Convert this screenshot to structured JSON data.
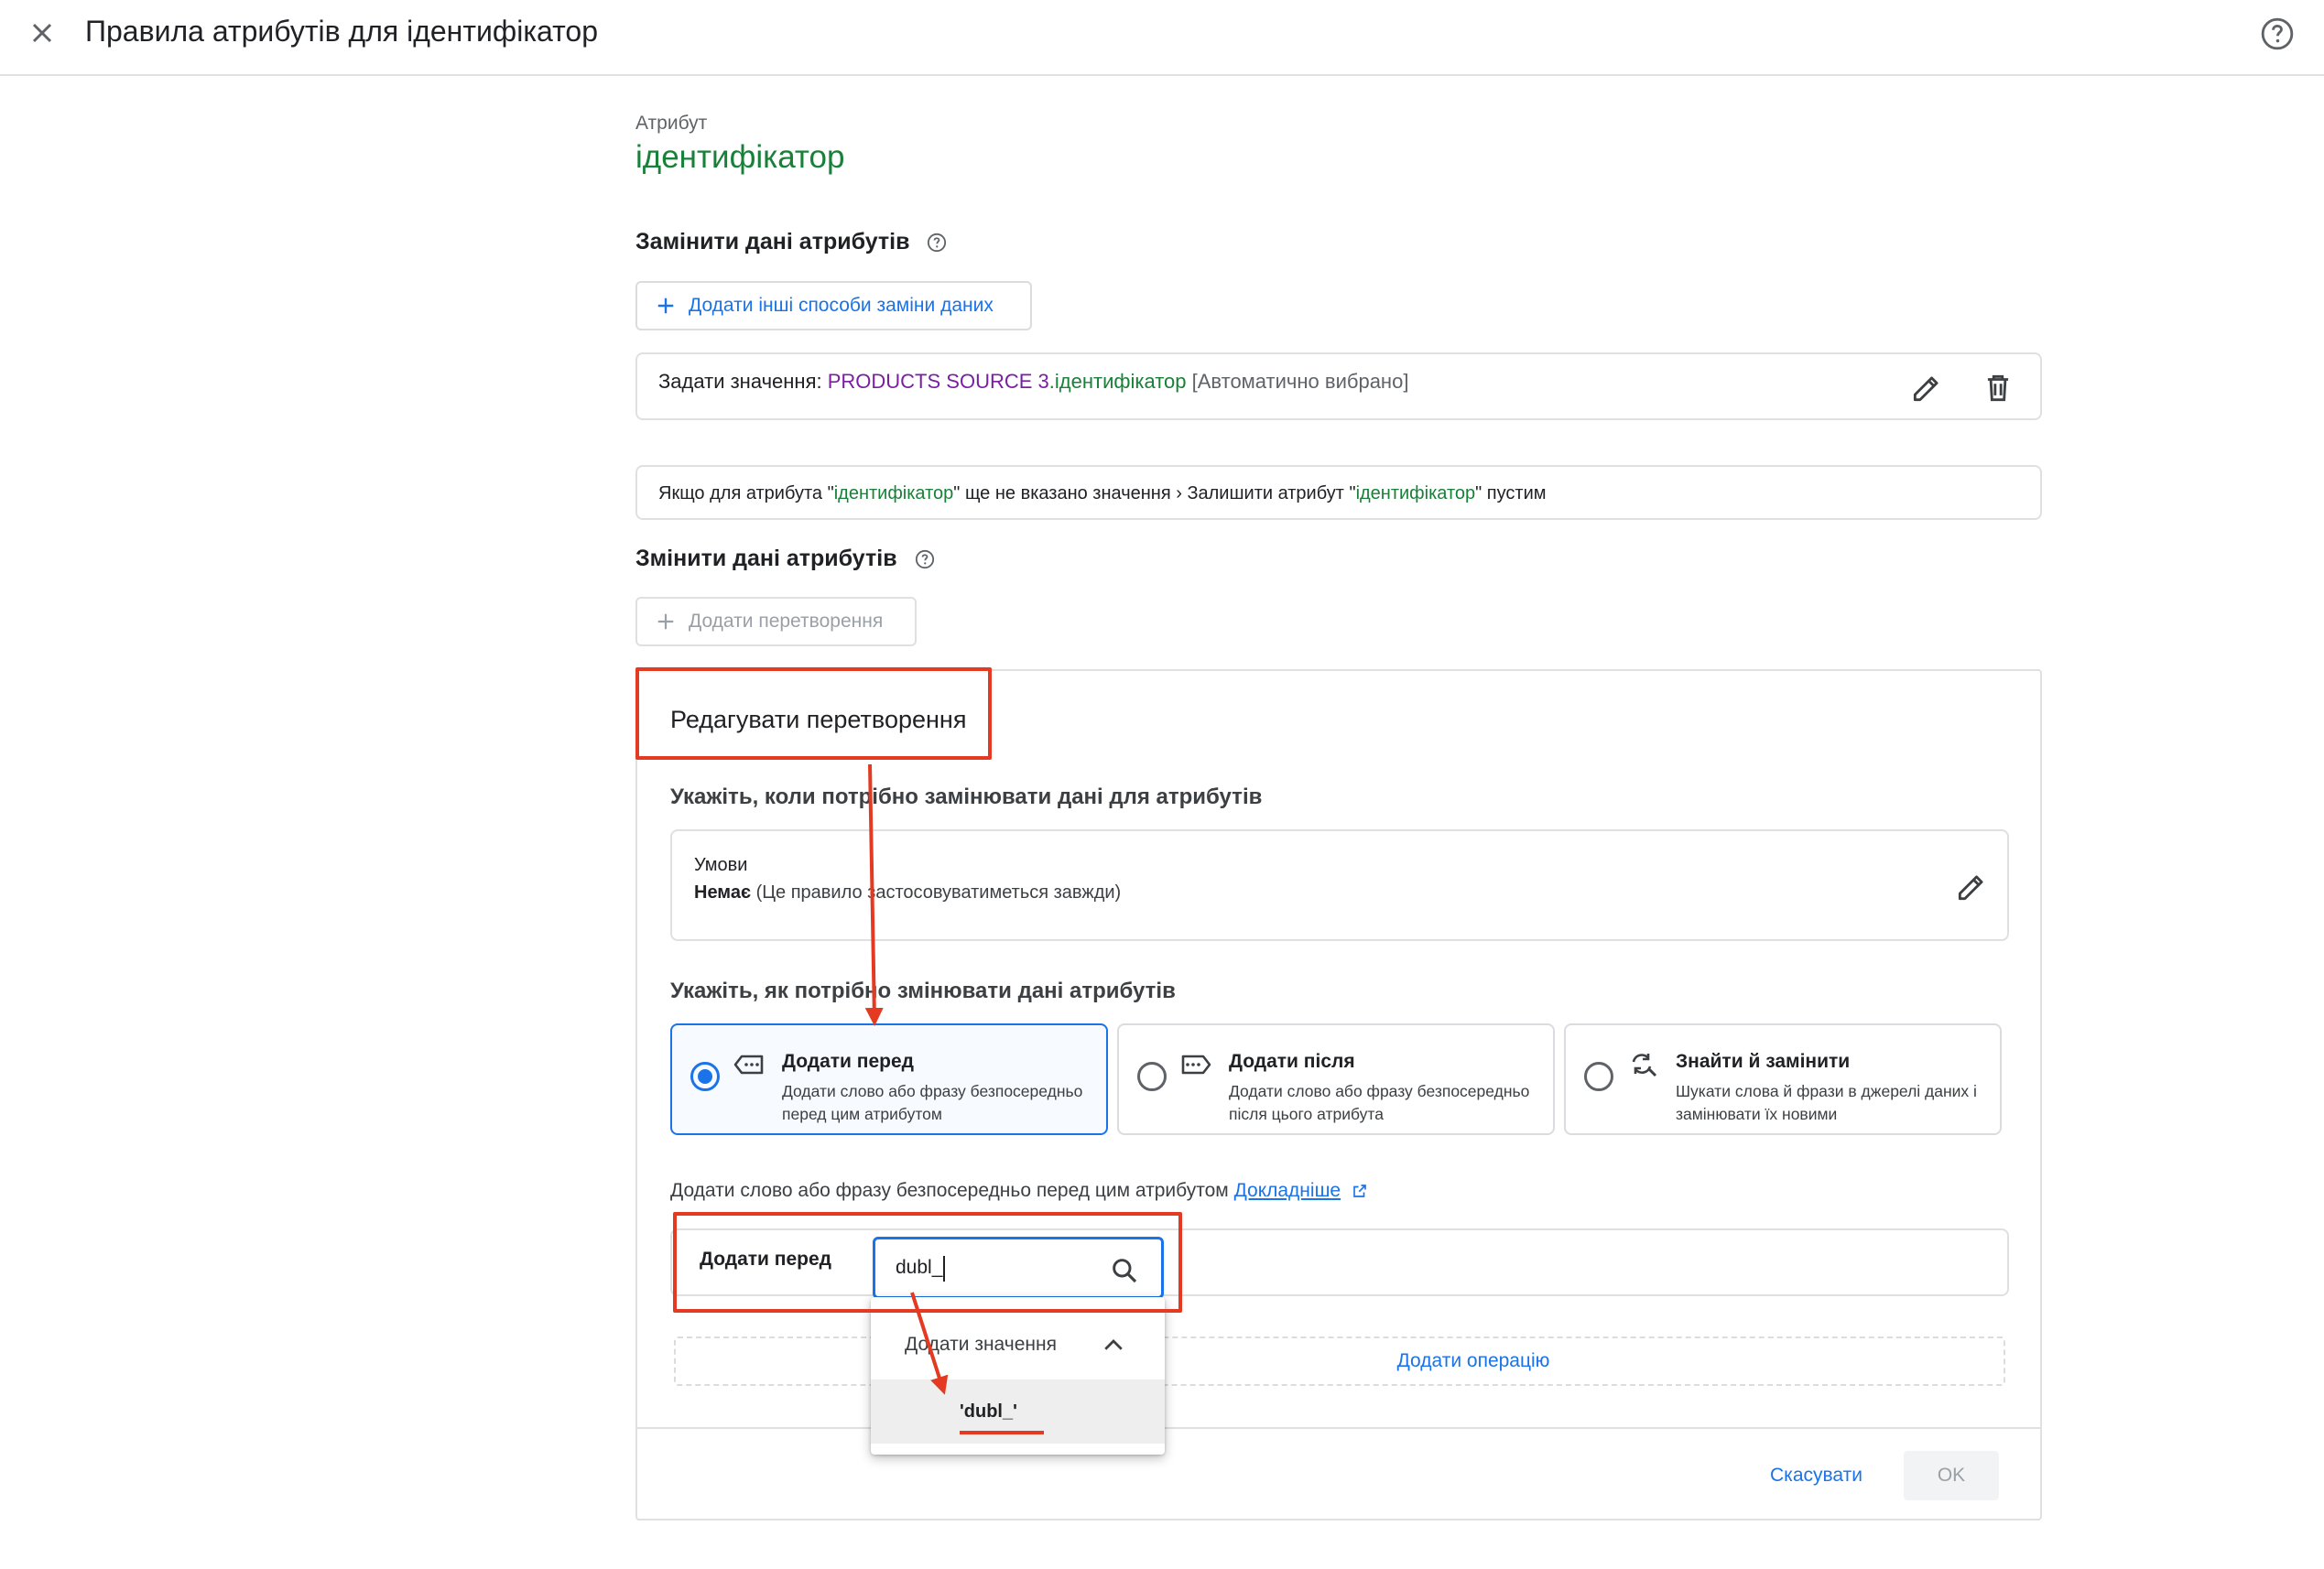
{
  "header": {
    "title": "Правила атрибутів для ідентифікатор"
  },
  "attribute": {
    "label": "Атрибут",
    "name": "ідентифікатор"
  },
  "replace_section": {
    "title": "Замінити дані атрибутів",
    "add_button": "Додати інші способи заміни даних",
    "rule": {
      "prefix": "Задати значення: ",
      "source": "PRODUCTS SOURCE 3",
      "dot": ".",
      "field": "ідентифікатор",
      "suffix": " [Автоматично вибрано]"
    },
    "fallback": {
      "p1": "Якщо для атрибута \"",
      "attr1": "ідентифікатор",
      "p2": "\" ще не вказано значення › Залишити атрибут \"",
      "attr2": "ідентифікатор",
      "p3": "\" пустим"
    }
  },
  "modify_section": {
    "title": "Змінити дані атрибутів",
    "add_button": "Додати перетворення"
  },
  "edit_panel": {
    "title": "Редагувати перетворення",
    "when_title": "Укажіть, коли потрібно замінювати дані для атрибутів",
    "conditions_label": "Умови",
    "conditions_value_bold": "Немає",
    "conditions_value_rest": " (Це правило застосовуватиметься завжди)",
    "how_title": "Укажіть, як потрібно змінювати дані атрибутів",
    "options": [
      {
        "title": "Додати перед",
        "desc": "Додати слово або фразу безпосередньо перед цим атрибутом",
        "selected": true,
        "icon": "tag-left-icon"
      },
      {
        "title": "Додати після",
        "desc": "Додати слово або фразу безпосередньо після цього атрибута",
        "selected": false,
        "icon": "tag-right-icon"
      },
      {
        "title": "Знайти й замінити",
        "desc": "Шукати слова й фрази в джерелі даних і замінювати їх новими",
        "selected": false,
        "icon": "find-replace-icon"
      }
    ],
    "hint_text": "Додати слово або фразу безпосередньо перед цим атрибутом ",
    "learn_more": "Докладніше",
    "field_label": "Додати перед",
    "input_value": "dubl_",
    "add_operation": "Додати операцію",
    "dropdown": {
      "header": "Додати значення",
      "item": "'dubl_'"
    },
    "cancel": "Скасувати",
    "ok": "OK"
  },
  "colors": {
    "accent": "#1a73e8",
    "attribute_green": "#188038",
    "source_purple": "#7b1fa2",
    "annotation_red": "#e53a22"
  }
}
